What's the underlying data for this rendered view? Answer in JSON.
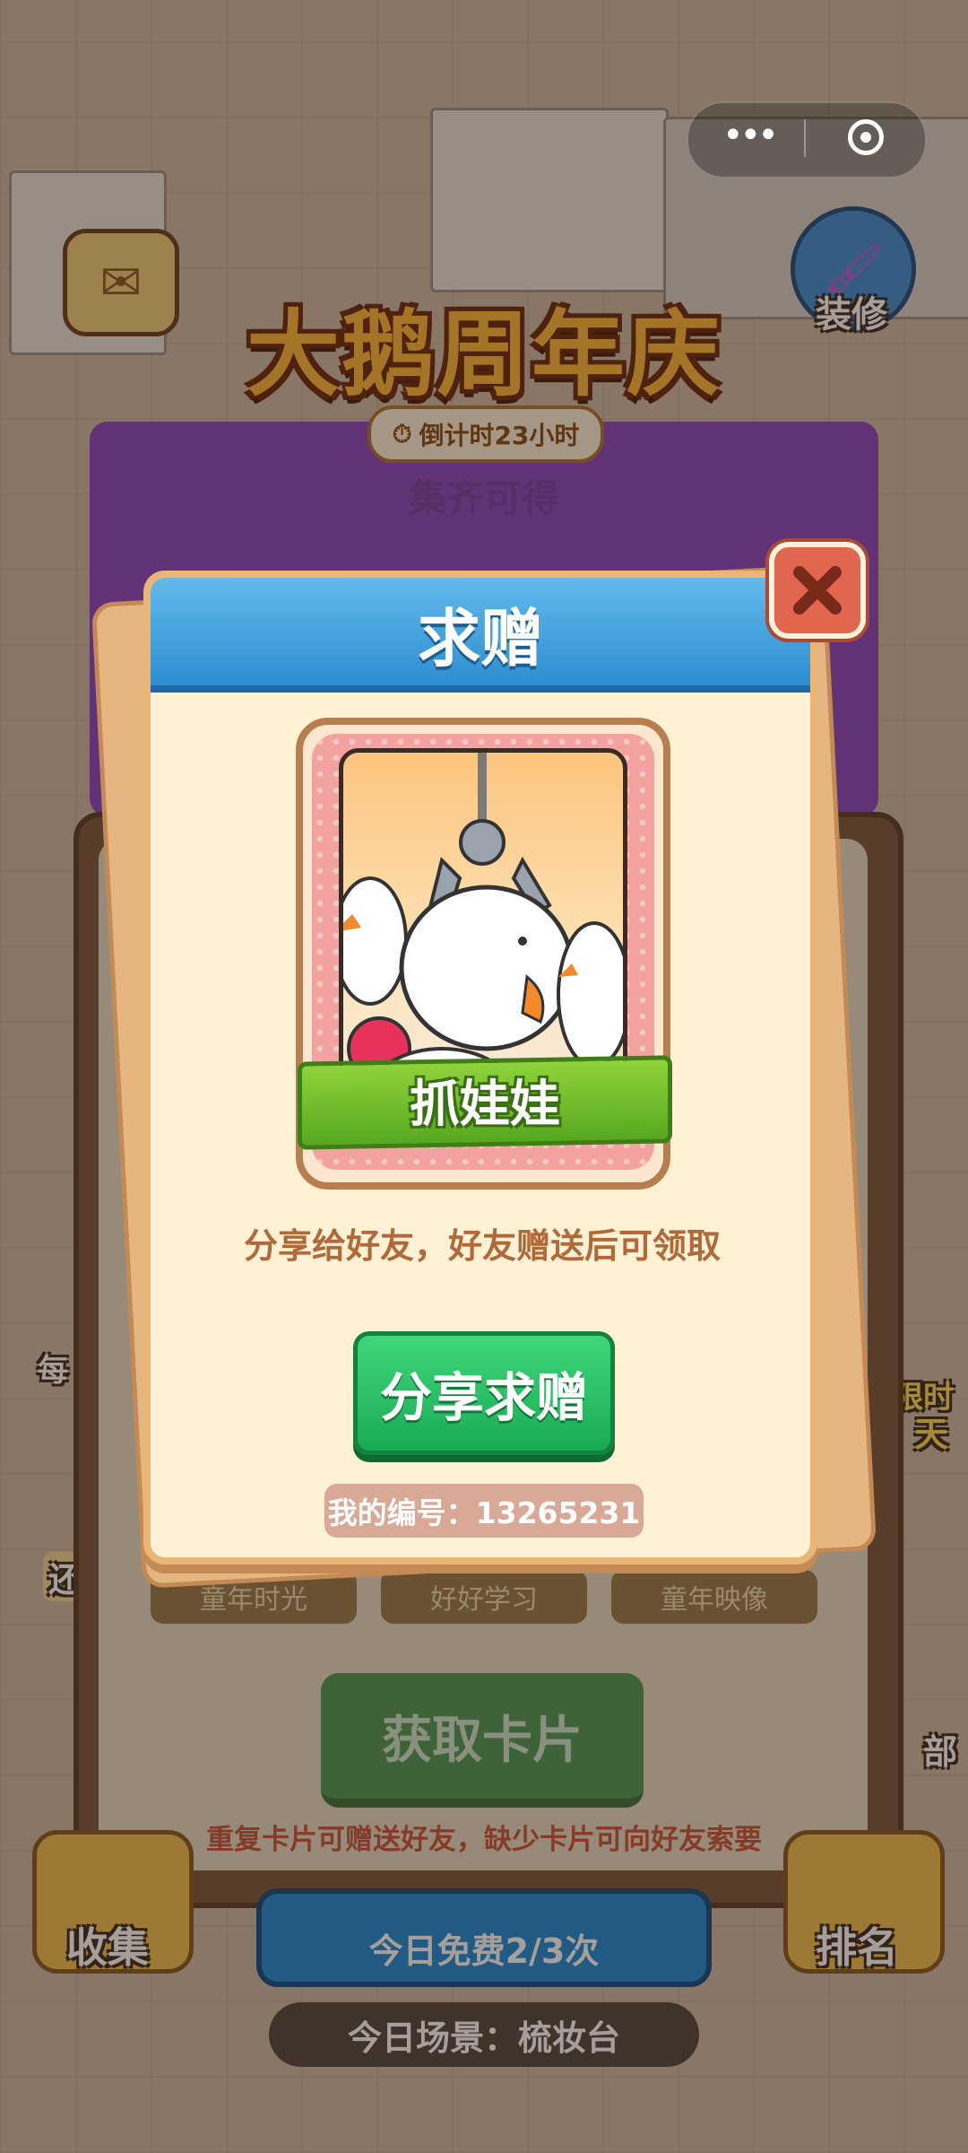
{
  "wechat_capsule": {
    "menu_icon": "more-dots-icon",
    "close_icon": "target-circle-icon"
  },
  "background": {
    "event_title": "大鹅周年庆",
    "countdown": "倒计时23小时",
    "collect_hint": "集齐可得",
    "decorate_label": "装修",
    "get_card_button": "获取卡片",
    "bottom_tip": "重复卡片可赠送好友，缺少卡片可向好友索要",
    "free_draws": "今日免费2/3次",
    "today_scene": "今日场景：梳妆台",
    "collect_label": "收集",
    "rank_label": "排名",
    "card_tabs": [
      "童年时光",
      "好好学习",
      "童年映像"
    ],
    "left_partial_labels": [
      "每",
      "还"
    ],
    "right_partial_labels": [
      "限时",
      "天",
      "部"
    ]
  },
  "modal": {
    "title": "求赠",
    "close_icon": "close-x-icon",
    "card_name": "抓娃娃",
    "share_tip": "分享给好友，好友赠送后可领取",
    "share_button": "分享求赠",
    "my_id": "我的编号：13265231"
  }
}
